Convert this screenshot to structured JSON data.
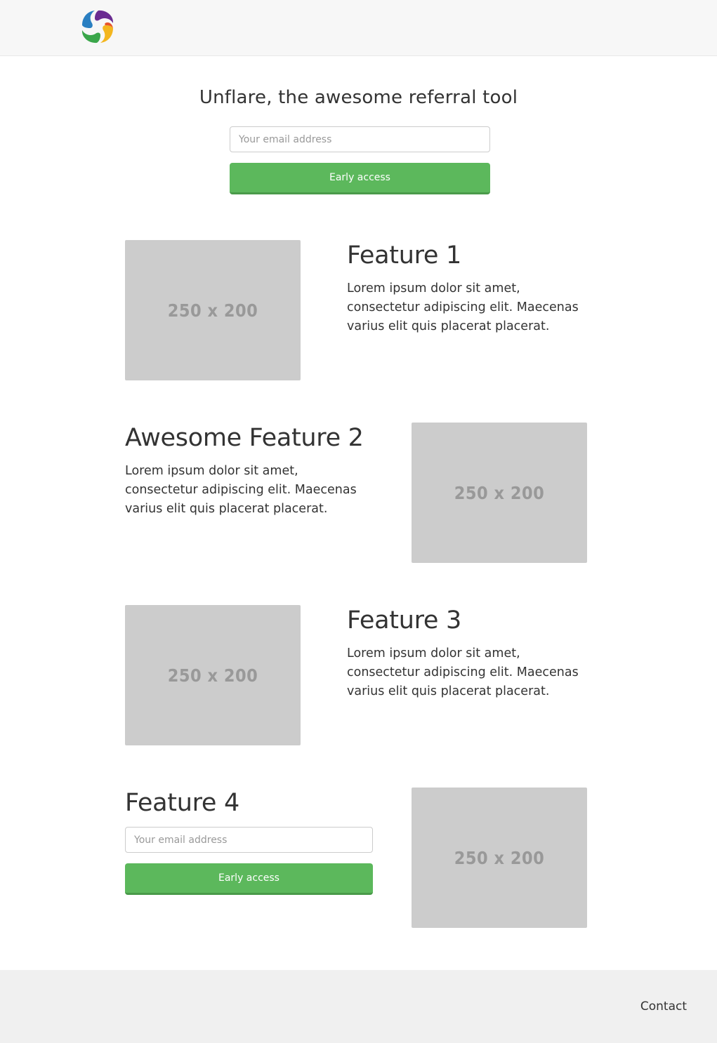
{
  "header": {
    "logo_icon": "swirl-logo-icon",
    "logo_colors": [
      "#6a2c91",
      "#2a7fc1",
      "#3aa64a",
      "#f3b61f"
    ]
  },
  "hero": {
    "title": "Unflare, the awesome referral tool",
    "email_placeholder": "Your email address",
    "cta_label": "Early access"
  },
  "features": [
    {
      "heading": "Feature 1",
      "text": "Lorem ipsum dolor sit amet, consectetur adipiscing elit. Maecenas varius elit quis placerat placerat.",
      "image_label": "250 x 200"
    },
    {
      "heading": "Awesome Feature 2",
      "text": "Lorem ipsum dolor sit amet, consectetur adipiscing elit. Maecenas varius elit quis placerat placerat.",
      "image_label": "250 x 200"
    },
    {
      "heading": "Feature 3",
      "text": "Lorem ipsum dolor sit amet, consectetur adipiscing elit. Maecenas varius elit quis placerat placerat.",
      "image_label": "250 x 200"
    },
    {
      "heading": "Feature 4",
      "email_placeholder": "Your email address",
      "cta_label": "Early access",
      "image_label": "250 x 200"
    }
  ],
  "footer": {
    "contact_label": "Contact"
  },
  "colors": {
    "cta": "#5cb85c",
    "placeholder_bg": "#cccccc",
    "navbar_bg": "#f7f7f7",
    "footer_bg": "#f0f0f0"
  }
}
